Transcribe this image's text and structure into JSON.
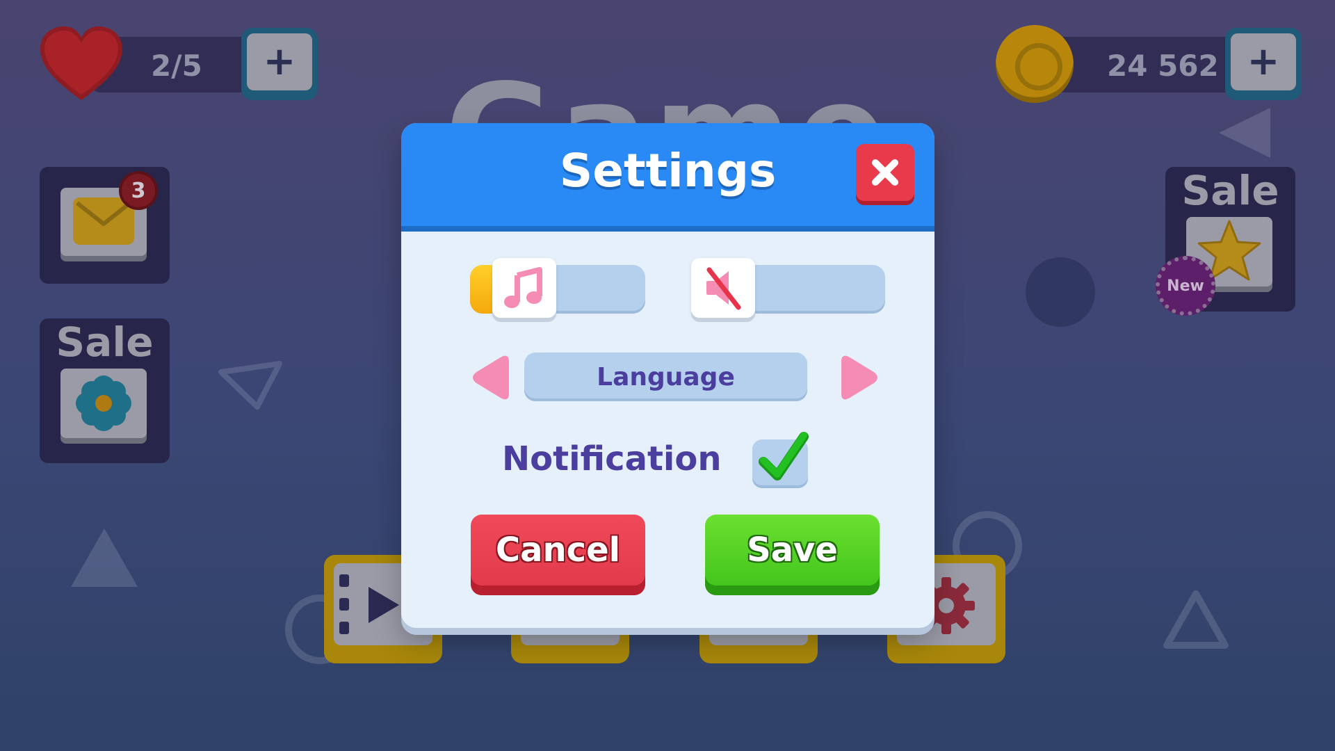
{
  "hud": {
    "lives": "2/5",
    "coins": "24 562",
    "add_lives_label": "+",
    "add_coins_label": "+"
  },
  "background": {
    "title_partial": "Game",
    "mail_badge_count": "3",
    "left_sale_label": "Sale",
    "right_sale_label": "Sale",
    "new_badge": "New"
  },
  "dialog": {
    "title": "Settings",
    "close_icon": "close-icon",
    "music": {
      "icon": "music-note-icon",
      "level": 0.2
    },
    "sound": {
      "icon": "sound-muted-icon",
      "level": 0.0
    },
    "language_label": "Language",
    "notification_label": "Notification",
    "notification_checked": true,
    "cancel_label": "Cancel",
    "save_label": "Save"
  },
  "colors": {
    "header_blue": "#2a8af5",
    "panel": "#e5f0fb",
    "cancel_red": "#e93a4b",
    "save_green": "#3fc21a",
    "text_purple": "#4b3e9e",
    "slider_fill": "#f5a90c",
    "accent_pink": "#f48cb4"
  }
}
